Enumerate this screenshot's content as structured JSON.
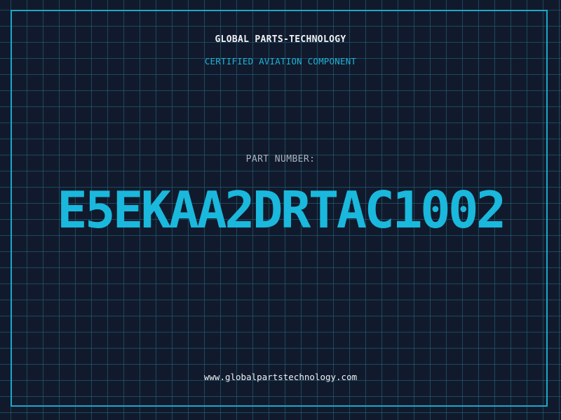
{
  "header": {
    "brand": "GLOBAL PARTS-TECHNOLOGY",
    "subtitle": "CERTIFIED AVIATION COMPONENT"
  },
  "part": {
    "label": "PART NUMBER:",
    "number": "E5EKAA2DRTAC1002"
  },
  "footer": {
    "website": "www.globalpartstechnology.com"
  },
  "colors": {
    "background": "#111a2c",
    "accent": "#1ab8dc",
    "grid": "#1f6e87",
    "text": "#eef2f6",
    "muted": "#aab3c0"
  }
}
